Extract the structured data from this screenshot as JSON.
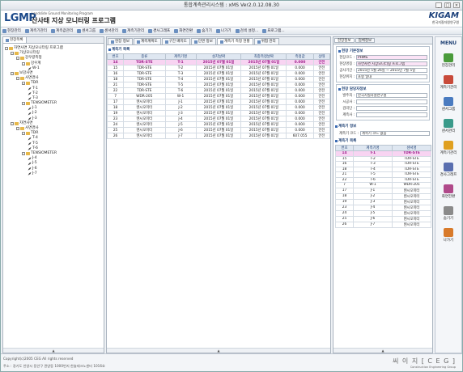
{
  "window": {
    "title": "통합계측관리시스템 : xMS Ver2.0.12.08.30"
  },
  "header": {
    "logo_main": "LGMP",
    "logo_sub": "Landslide Ground Monitoring Program",
    "logo_kor": "산사태 지상 모니터링 프로그램",
    "org_logo": "KIGAM",
    "org_name": "한국지질자원연구원"
  },
  "menubar": [
    {
      "label": "현장관리",
      "icon": "site-icon"
    },
    {
      "label": "계측기관리",
      "icon": "instrument-icon"
    },
    {
      "label": "계측값관리",
      "icon": "data-icon"
    },
    {
      "label": "센서그룹",
      "icon": "sensor-group-icon"
    },
    {
      "label": "센서관리",
      "icon": "sensor-icon"
    },
    {
      "label": "계측기관리",
      "icon": "gauge-icon"
    },
    {
      "label": "경사그래프",
      "icon": "graph-icon"
    },
    {
      "label": "화면전환",
      "icon": "switch-icon"
    },
    {
      "label": "숨기기",
      "icon": "hide-icon"
    },
    {
      "label": "나가기",
      "icon": "exit-icon"
    },
    {
      "label": "검색 설정...",
      "icon": "search-icon"
    },
    {
      "label": "프로그램...",
      "icon": "program-icon"
    }
  ],
  "left_panel": {
    "tab": "현장목록",
    "tree": [
      {
        "level": 0,
        "type": "root",
        "label": "자연사면 지상모니터링 프로그램"
      },
      {
        "level": 1,
        "type": "folder",
        "label": "가상모니터링"
      },
      {
        "level": 2,
        "type": "folder",
        "label": "강우량측정"
      },
      {
        "level": 3,
        "type": "folder",
        "label": "강우계"
      },
      {
        "level": 4,
        "type": "sensor",
        "label": "W-1"
      },
      {
        "level": 1,
        "type": "folder",
        "label": "보강사면"
      },
      {
        "level": 2,
        "type": "folder",
        "label": "사면경사"
      },
      {
        "level": 3,
        "type": "folder",
        "label": "TDR"
      },
      {
        "level": 4,
        "type": "sensor",
        "label": "T-1"
      },
      {
        "level": 4,
        "type": "sensor",
        "label": "T-2"
      },
      {
        "level": 4,
        "type": "sensor",
        "label": "T-3"
      },
      {
        "level": 3,
        "type": "folder",
        "label": "TENSIOMETER"
      },
      {
        "level": 4,
        "type": "sensor",
        "label": "J-1"
      },
      {
        "level": 4,
        "type": "sensor",
        "label": "J-2"
      },
      {
        "level": 4,
        "type": "sensor",
        "label": "J-3"
      },
      {
        "level": 1,
        "type": "folder",
        "label": "자연사면"
      },
      {
        "level": 2,
        "type": "folder",
        "label": "사면경사"
      },
      {
        "level": 3,
        "type": "folder",
        "label": "TDR"
      },
      {
        "level": 4,
        "type": "sensor",
        "label": "T-4"
      },
      {
        "level": 4,
        "type": "sensor",
        "label": "T-5"
      },
      {
        "level": 4,
        "type": "sensor",
        "label": "T-6"
      },
      {
        "level": 3,
        "type": "folder",
        "label": "TENSIOMETER"
      },
      {
        "level": 4,
        "type": "sensor",
        "label": "J-4"
      },
      {
        "level": 4,
        "type": "sensor",
        "label": "J-5"
      },
      {
        "level": 4,
        "type": "sensor",
        "label": "J-6"
      },
      {
        "level": 4,
        "type": "sensor",
        "label": "J-7"
      }
    ]
  },
  "center_panel": {
    "tabs": [
      "현장 정보",
      "계측계획도",
      "구간 배치도",
      "단면 정보",
      "계측기 측정 현황",
      "위험 관리"
    ],
    "active_tab_index": 4,
    "section_title": "계측기 목록",
    "columns": [
      "번호",
      "종류",
      "계측기명",
      "설치날짜",
      "최종측정날짜",
      "측정값",
      "상태"
    ],
    "rows": [
      [
        "14",
        "TDR-STE",
        "T-1",
        "2015년 07월 01일",
        "2015년 07월 01일",
        "0.000",
        "안전"
      ],
      [
        "15",
        "TDR-STE",
        "T-2",
        "2015년 07월 01일",
        "2015년 07월 01일",
        "0.000",
        "안전"
      ],
      [
        "16",
        "TDR-STE",
        "T-3",
        "2015년 07월 01일",
        "2015년 07월 01일",
        "0.000",
        "안전"
      ],
      [
        "18",
        "TDR-STE",
        "T-4",
        "2015년 07월 01일",
        "2015년 07월 01일",
        "0.000",
        "안전"
      ],
      [
        "21",
        "TDR-STE",
        "T-5",
        "2015년 07월 01일",
        "2015년 07월 01일",
        "0.000",
        "안전"
      ],
      [
        "22",
        "TDR-STE",
        "T-6",
        "2015년 07월 01일",
        "2015년 07월 01일",
        "0.000",
        "안전"
      ],
      [
        "7",
        "WDR-205",
        "W-1",
        "2015년 07월 01일",
        "2015년 07월 01일",
        "0.000",
        "안전"
      ],
      [
        "17",
        "텐시오미터",
        "J-1",
        "2015년 07월 01일",
        "2015년 07월 01일",
        "0.000",
        "안전"
      ],
      [
        "18",
        "텐시오미터",
        "J-2",
        "2015년 07월 01일",
        "2015년 07월 01일",
        "0.000",
        "안전"
      ],
      [
        "19",
        "텐시오미터",
        "J-3",
        "2015년 07월 01일",
        "2015년 07월 01일",
        "0.000",
        "안전"
      ],
      [
        "23",
        "텐시오미터",
        "J-4",
        "2015년 07월 01일",
        "2015년 07월 01일",
        "0.000",
        "안전"
      ],
      [
        "24",
        "텐시오미터",
        "J-5",
        "2015년 07월 01일",
        "2015년 07월 01일",
        "0.000",
        "안전"
      ],
      [
        "25",
        "텐시오미터",
        "J-6",
        "2015년 07월 01일",
        "2015년 07월 01일",
        "0.000",
        "안전"
      ],
      [
        "26",
        "텐시오미터",
        "J-7",
        "2015년 07월 01일",
        "2015년 07월 01일",
        "607.055",
        "안전"
      ]
    ]
  },
  "right_panel": {
    "tabs": [
      "현장정보",
      "업체정보"
    ],
    "basic_title": "현장 기본정보",
    "fields": [
      {
        "label": "현장코드 :",
        "value": "PHMS"
      },
      {
        "label": "현장명칭 :",
        "value": "자연사면 지상모니터링 프로그램"
      },
      {
        "label": "공사기간 :",
        "value": "2015년 5월 26일 ~ 2015년 7월 5일"
      },
      {
        "label": "현장위치 :",
        "value": "포항 일대"
      }
    ],
    "manager_title": "현장 담당자정보",
    "manager_fields": [
      {
        "label": "발주처 :",
        "value": "한국지질자원연구원"
      },
      {
        "label": "시공사 :",
        "value": ""
      },
      {
        "label": "감리단 :",
        "value": ""
      },
      {
        "label": "계측사 :",
        "value": ""
      }
    ],
    "group_title": "계측기 정보",
    "group_code_label": "계측기 코드 :",
    "group_code_value": "계측기 코드 없음",
    "list_title": "계측기 목록",
    "list_columns": [
      "번호",
      "계측기명",
      "센서명"
    ],
    "list_rows": [
      [
        "14",
        "T-1",
        "TDR-STE"
      ],
      [
        "15",
        "T-2",
        "TDR-STE"
      ],
      [
        "16",
        "T-3",
        "TDR-STE"
      ],
      [
        "18",
        "T-4",
        "TDR-STE"
      ],
      [
        "21",
        "T-5",
        "TDR-STE"
      ],
      [
        "22",
        "T-6",
        "TDR-STE"
      ],
      [
        "7",
        "W-1",
        "WDR-205"
      ],
      [
        "17",
        "J-1",
        "텐시오미터"
      ],
      [
        "18",
        "J-2",
        "텐시오미터"
      ],
      [
        "19",
        "J-3",
        "텐시오미터"
      ],
      [
        "23",
        "J-4",
        "텐시오미터"
      ],
      [
        "24",
        "J-5",
        "텐시오미터"
      ],
      [
        "25",
        "J-6",
        "텐시오미터"
      ],
      [
        "26",
        "J-7",
        "텐시오미터"
      ]
    ]
  },
  "side_menu": {
    "title": "MENU",
    "items": [
      {
        "label": "현장관리",
        "color": "#4a9b3b"
      },
      {
        "label": "계측기관리",
        "color": "#c84a3a"
      },
      {
        "label": "센서그룹",
        "color": "#4a7bc0"
      },
      {
        "label": "센서관리",
        "color": "#3a9a8a"
      },
      {
        "label": "계측기관리",
        "color": "#e0a020"
      },
      {
        "label": "경사그래프",
        "color": "#5a6fb0"
      },
      {
        "label": "화면전환",
        "color": "#b04a8a"
      },
      {
        "label": "숨기기",
        "color": "#8a8a8a"
      },
      {
        "label": "나가기",
        "color": "#d87a2a"
      }
    ]
  },
  "status": {
    "copyright": "Copyright(c)2005 CEG All rights reserved",
    "address": "주소 : 경기도 안양시 동안구 관양동 1000번지 한솔테크노센터 1016호",
    "company": "씨 이 지 [ C E G ]",
    "company_en": "Construction Engineering Group"
  }
}
